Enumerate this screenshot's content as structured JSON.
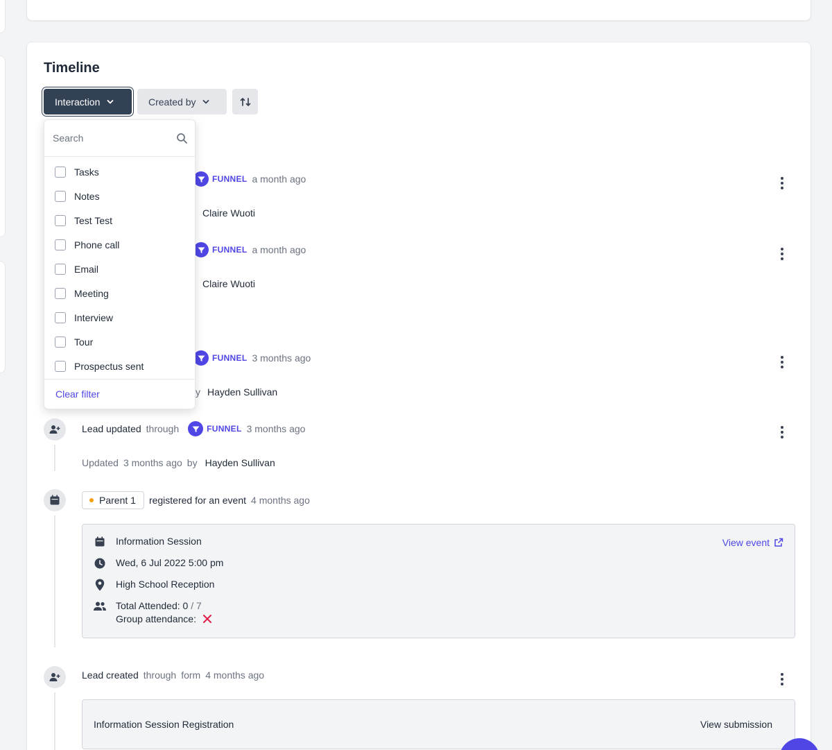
{
  "timeline": {
    "title": "Timeline",
    "filters": {
      "interaction_label": "Interaction",
      "created_by_label": "Created by"
    },
    "dropdown": {
      "search_placeholder": "Search",
      "options": [
        "Tasks",
        "Notes",
        "Test Test",
        "Phone call",
        "Email",
        "Meeting",
        "Interview",
        "Tour",
        "Prospectus sent"
      ],
      "clear_label": "Clear filter"
    },
    "entries": [
      {
        "source": "FUNNEL",
        "time": "a month ago",
        "person": "Claire Wuoti"
      },
      {
        "source": "FUNNEL",
        "time": "a month ago",
        "person": "Claire Wuoti"
      },
      {
        "source": "FUNNEL",
        "time": "3 months ago",
        "by_fragment": "y",
        "person": "Hayden Sullivan"
      },
      {
        "action": "Lead updated",
        "through": "through",
        "source": "FUNNEL",
        "time": "3 months ago",
        "updated_label": "Updated",
        "updated_time": "3 months ago",
        "by": "by",
        "person": "Hayden Sullivan"
      }
    ],
    "event_entry": {
      "tag": "Parent 1",
      "text": "registered for an event",
      "time": "4 months ago",
      "event_name": "Information Session",
      "view_event": "View event",
      "datetime": "Wed, 6 Jul 2022 5:00 pm",
      "location": "High School Reception",
      "attended_label": "Total Attended: 0",
      "attended_total": "/ 7",
      "group_attendance_label": "Group attendance:"
    },
    "created_entry": {
      "action": "Lead created",
      "through": "through",
      "form": "form",
      "time": "4 months ago",
      "submission_title": "Information Session Registration",
      "view_submission": "View submission"
    }
  },
  "colors": {
    "accent": "#4f46e5",
    "dark_button": "#334155",
    "danger": "#e11d48",
    "status_dot": "#f59e0b"
  }
}
